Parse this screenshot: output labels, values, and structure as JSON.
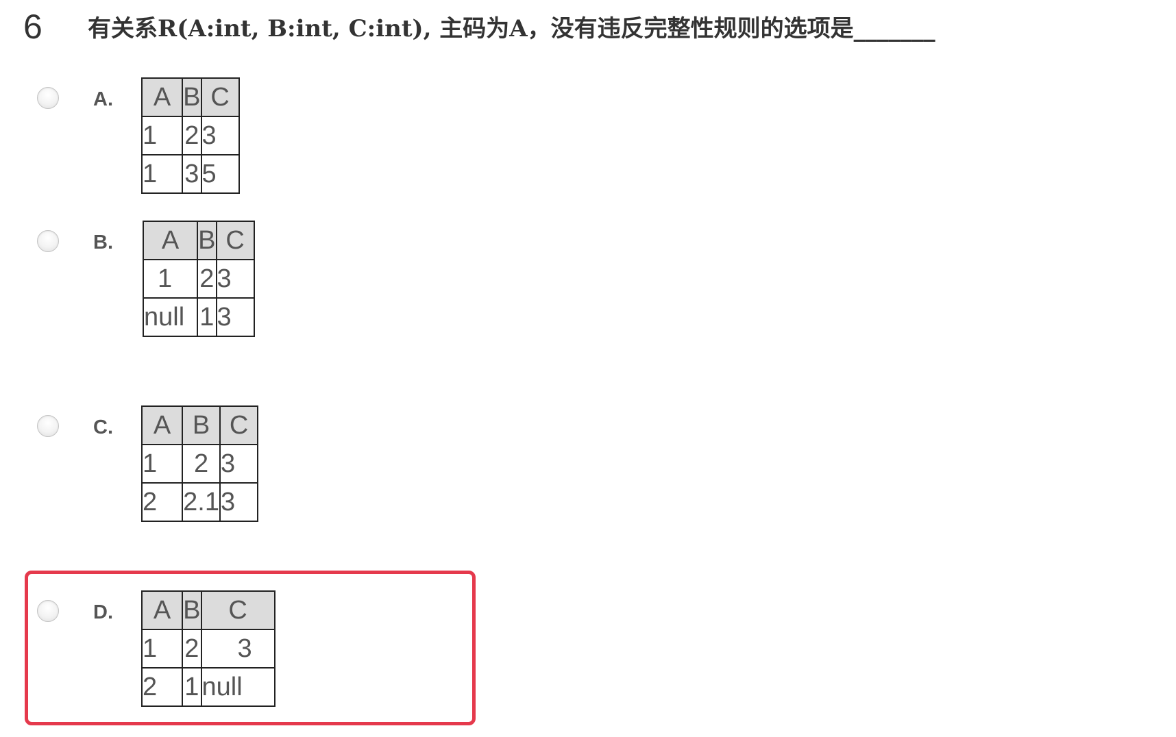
{
  "question": {
    "number": "6",
    "text": "有关系R(A:int, B:int, C:int), 主码为A，没有违反完整性规则的选项是_______"
  },
  "options": [
    {
      "label": "A.",
      "headers": [
        "A",
        "B",
        "C"
      ],
      "rows": [
        [
          "1",
          "2",
          "3"
        ],
        [
          "1",
          "3",
          "5"
        ]
      ]
    },
    {
      "label": "B.",
      "headers": [
        "A",
        "B",
        "C"
      ],
      "rows": [
        [
          "1",
          "2",
          "3"
        ],
        [
          "null",
          "1",
          "3"
        ]
      ]
    },
    {
      "label": "C.",
      "headers": [
        "A",
        "B",
        "C"
      ],
      "rows": [
        [
          "1",
          "2",
          "3"
        ],
        [
          "2",
          "2.1",
          "3"
        ]
      ]
    },
    {
      "label": "D.",
      "headers": [
        "A",
        "B",
        "C"
      ],
      "rows": [
        [
          "1",
          "2",
          "3"
        ],
        [
          "2",
          "1",
          "null"
        ]
      ]
    }
  ],
  "highlighted_option": "D.",
  "colors": {
    "highlight": "#e5394c",
    "header_bg": "#dcdcdc"
  }
}
